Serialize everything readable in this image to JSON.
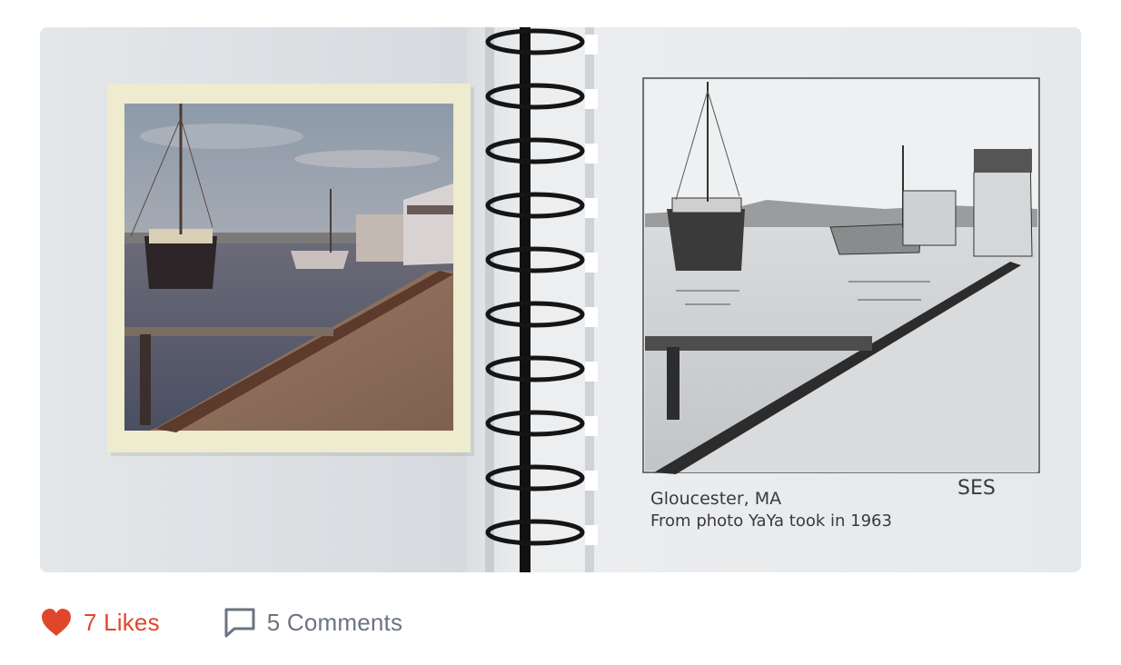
{
  "post": {
    "image": {
      "polaroid_subject": "harbor-photo",
      "sketch_caption_line1": "Gloucester, MA",
      "sketch_caption_line2": "From photo YaYa took in 1963",
      "sketch_signature": "SES"
    },
    "likes": {
      "label": "7 Likes",
      "icon": "heart-icon",
      "color": "#e0462b"
    },
    "comments": {
      "label": "5 Comments",
      "icon": "comment-bubble-icon",
      "color": "#6b7480"
    }
  }
}
